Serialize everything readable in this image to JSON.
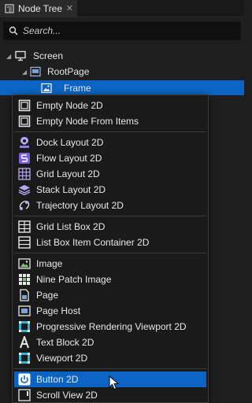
{
  "tab": {
    "label": "Node Tree",
    "close": "✕"
  },
  "search": {
    "placeholder": "Search..."
  },
  "tree": {
    "screen": "Screen",
    "rootpage": "RootPage",
    "frame": "Frame"
  },
  "menu": {
    "empty_node_2d": "Empty Node 2D",
    "empty_node_from_items": "Empty Node From Items",
    "dock_layout_2d": "Dock Layout 2D",
    "flow_layout_2d": "Flow Layout 2D",
    "grid_layout_2d": "Grid Layout 2D",
    "stack_layout_2d": "Stack Layout 2D",
    "trajectory_layout_2d": "Trajectory Layout 2D",
    "grid_list_box_2d": "Grid List Box 2D",
    "list_box_item_container_2d": "List Box Item Container 2D",
    "image": "Image",
    "nine_patch_image": "Nine Patch Image",
    "page": "Page",
    "page_host": "Page Host",
    "progressive_rendering_viewport_2d": "Progressive Rendering Viewport 2D",
    "text_block_2d": "Text Block 2D",
    "viewport_2d": "Viewport 2D",
    "button_2d": "Button 2D",
    "scroll_view_2d": "Scroll View 2D"
  },
  "colors": {
    "accent": "#0b64c4",
    "background": "#1e1e1e",
    "menu_background": "#1a1a1a"
  }
}
